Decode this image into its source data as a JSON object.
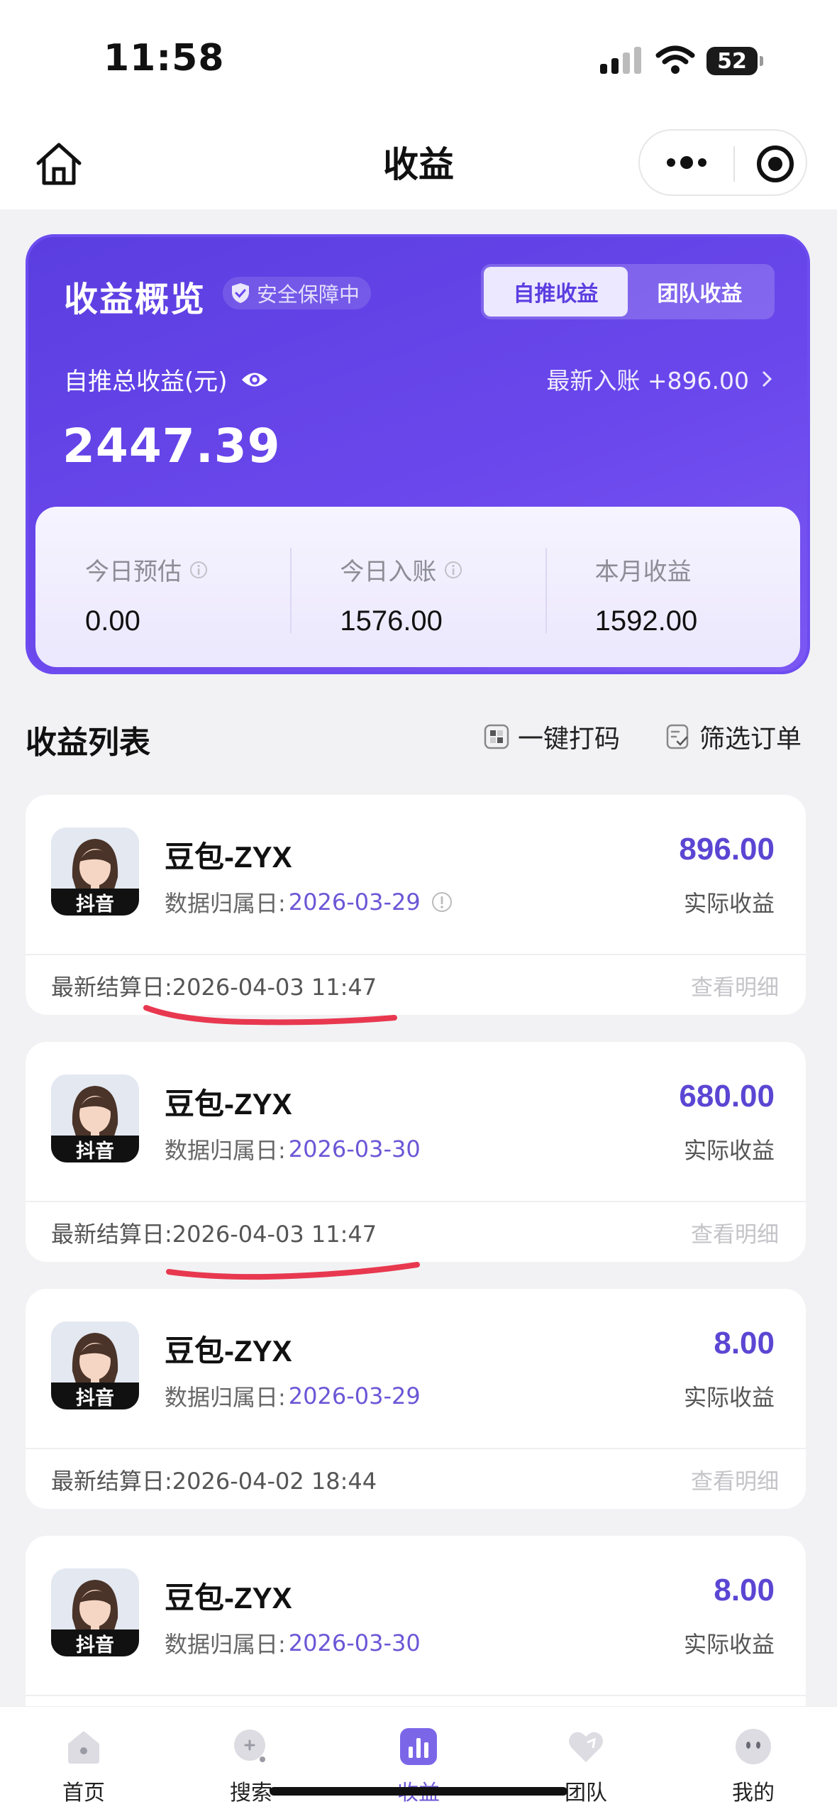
{
  "status_bar": {
    "time": "11:58",
    "battery": "52"
  },
  "nav": {
    "title": "收益"
  },
  "overview": {
    "title": "收益概览",
    "safe_badge": "安全保障中",
    "tabs": [
      {
        "label": "自推收益",
        "active": true
      },
      {
        "label": "团队收益",
        "active": false
      }
    ],
    "total_label": "自推总收益(元)",
    "latest_label": "最新入账 +896.00",
    "total_value": "2447.39",
    "stats": [
      {
        "label": "今日预估",
        "value": "0.00"
      },
      {
        "label": "今日入账",
        "value": "1576.00"
      },
      {
        "label": "本月收益",
        "value": "1592.00"
      }
    ]
  },
  "list": {
    "title": "收益列表",
    "encode_label": "一键打码",
    "filter_label": "筛选订单",
    "items": [
      {
        "platform": "抖音",
        "name": "豆包-ZYX",
        "date_label": "数据归属日:",
        "date": "2026-03-29",
        "amount": "896.00",
        "amount_label": "实际收益",
        "settle": "最新结算日:2026-04-03 11:47",
        "detail": "查看明细"
      },
      {
        "platform": "抖音",
        "name": "豆包-ZYX",
        "date_label": "数据归属日:",
        "date": "2026-03-30",
        "amount": "680.00",
        "amount_label": "实际收益",
        "settle": "最新结算日:2026-04-03 11:47",
        "detail": "查看明细"
      },
      {
        "platform": "抖音",
        "name": "豆包-ZYX",
        "date_label": "数据归属日:",
        "date": "2026-03-29",
        "amount": "8.00",
        "amount_label": "实际收益",
        "settle": "最新结算日:2026-04-02 18:44",
        "detail": "查看明细"
      },
      {
        "platform": "抖音",
        "name": "豆包-ZYX",
        "date_label": "数据归属日:",
        "date": "2026-03-30",
        "amount": "8.00",
        "amount_label": "实际收益"
      }
    ]
  },
  "tab_bar": {
    "items": [
      {
        "label": "首页",
        "icon": "home-icon",
        "active": false
      },
      {
        "label": "搜索",
        "icon": "search-icon",
        "active": false
      },
      {
        "label": "收益",
        "icon": "chart-icon",
        "active": true
      },
      {
        "label": "团队",
        "icon": "heart-icon",
        "active": false
      },
      {
        "label": "我的",
        "icon": "face-icon",
        "active": false
      }
    ]
  },
  "colors": {
    "primary": "#5b3ee0",
    "accent_text": "#6b57d6",
    "underline": "#e8384f"
  }
}
